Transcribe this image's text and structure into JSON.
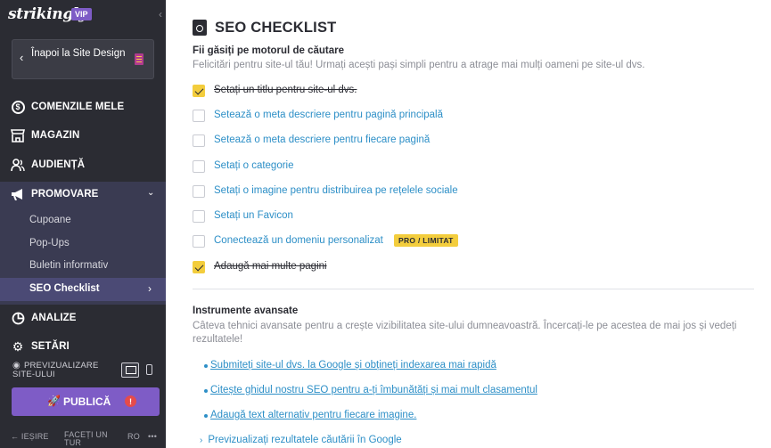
{
  "sidebar": {
    "logo": "strikingly",
    "vip_badge": "VIP",
    "back_label": "Înapoi la Site Design",
    "nav": [
      {
        "label": "COMENZILE MELE",
        "icon": "dollar-circle-icon"
      },
      {
        "label": "MAGAZIN",
        "icon": "store-icon"
      },
      {
        "label": "AUDIENȚĂ",
        "icon": "people-icon"
      },
      {
        "label": "PROMOVARE",
        "icon": "megaphone-icon"
      }
    ],
    "promo_sub": [
      "Cupoane",
      "Pop-Ups",
      "Buletin informativ"
    ],
    "seo_active": "SEO Checklist",
    "nav_after": [
      {
        "label": "ANALIZE",
        "icon": "pie-chart-icon"
      },
      {
        "label": "SETĂRI",
        "icon": "gear-icon"
      }
    ],
    "preview_label": "PREVIZUALIZARE SITE-ULUI",
    "publish_label": "PUBLICĂ",
    "publish_alert": "!",
    "footer": {
      "exit": "← IEȘIRE",
      "tour": "FACEȚI UN TUR",
      "lang": "RO",
      "more": "•••"
    }
  },
  "main": {
    "title": "SEO CHECKLIST",
    "section1": {
      "heading": "Fii găsiți pe motorul de căutare",
      "subtitle": "Felicitări pentru site-ul tău! Urmați acești pași simpli pentru a atrage mai mulți oameni pe site-ul dvs.",
      "items": [
        {
          "label": "Setați un titlu pentru site-ul dvs.",
          "checked": true
        },
        {
          "label": "Setează o meta descriere pentru pagină principală",
          "checked": false
        },
        {
          "label": "Setează o meta descriere pentru fiecare pagină",
          "checked": false
        },
        {
          "label": "Setați o categorie",
          "checked": false
        },
        {
          "label": "Setați o imagine pentru distribuirea pe rețelele sociale",
          "checked": false
        },
        {
          "label": "Setați un Favicon",
          "checked": false
        },
        {
          "label": "Conectează un domeniu personalizat",
          "checked": false,
          "badge": "PRO / LIMITAT"
        },
        {
          "label": "Adaugă mai multe pagini",
          "checked": true
        }
      ]
    },
    "section2": {
      "heading": "Instrumente avansate",
      "subtitle": "Câteva tehnici avansate pentru a crește vizibilitatea site-ului dumneavoastră. Încercați-le pe acestea de mai jos și vedeți rezultatele!",
      "links": [
        "Submiteți site-ul dvs. la Google și obțineți indexarea mai rapidă",
        "Citește ghidul nostru SEO pentru a-ți îmbunătăți și mai mult clasamentul",
        "Adaugă text alternativ pentru fiecare imagine."
      ],
      "preview_link": "Previzualizați rezultatele căutării în Google"
    }
  },
  "colors": {
    "sidebar": "#2b2c33",
    "accent": "#7e5cc6",
    "check": "#f3cd3d",
    "link": "#2d8fc7"
  }
}
